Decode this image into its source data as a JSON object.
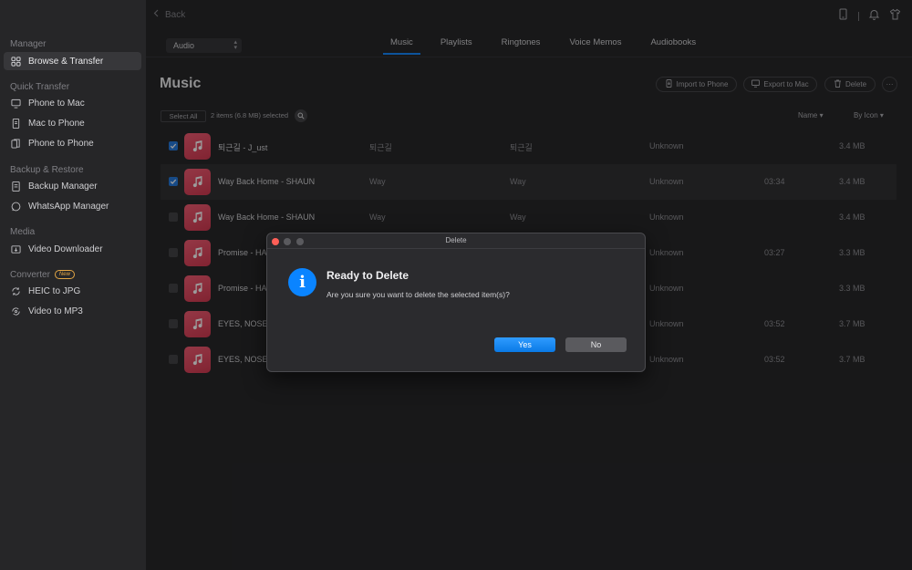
{
  "sidebar": {
    "sections": [
      {
        "label": "Manager",
        "items": [
          {
            "label": "Browse & Transfer",
            "icon": "grid-icon",
            "active": true
          }
        ]
      },
      {
        "label": "Quick Transfer",
        "items": [
          {
            "label": "Phone to Mac",
            "icon": "monitor-icon"
          },
          {
            "label": "Mac to Phone",
            "icon": "phone-icon"
          },
          {
            "label": "Phone to Phone",
            "icon": "phones-icon"
          }
        ]
      },
      {
        "label": "Backup & Restore",
        "items": [
          {
            "label": "Backup Manager",
            "icon": "backup-icon"
          },
          {
            "label": "WhatsApp Manager",
            "icon": "whatsapp-icon"
          }
        ]
      },
      {
        "label": "Media",
        "items": [
          {
            "label": "Video Downloader",
            "icon": "download-icon"
          }
        ]
      },
      {
        "label": "Converter",
        "badge": "New",
        "items": [
          {
            "label": "HEIC to JPG",
            "icon": "convert-icon"
          },
          {
            "label": "Video to MP3",
            "icon": "music-convert-icon"
          }
        ]
      }
    ]
  },
  "header": {
    "back_label": "Back",
    "audio_select": "Audio",
    "tabs": [
      "Music",
      "Playlists",
      "Ringtones",
      "Voice Memos",
      "Audiobooks"
    ],
    "active_tab": "Music"
  },
  "main": {
    "title": "Music",
    "actions": {
      "import": "Import to Phone",
      "export": "Export to Mac",
      "delete": "Delete",
      "more": "···"
    },
    "select_all": "Select All",
    "selection_count": "2 items (6.8 MB) selected",
    "sort_name": "Name",
    "sort_view": "By Icon",
    "rows": [
      {
        "title": "퇴근길 - J_ust",
        "artist": "퇴근길",
        "album": "퇴근길",
        "genre": "Unknown",
        "duration": "",
        "size": "3.4 MB",
        "checked": true
      },
      {
        "title": "Way Back Home - SHAUN",
        "artist": "Way",
        "album": "Way",
        "genre": "Unknown",
        "duration": "03:34",
        "size": "3.4 MB",
        "checked": true
      },
      {
        "title": "Way Back Home - SHAUN",
        "artist": "Way",
        "album": "Way",
        "genre": "Unknown",
        "duration": "",
        "size": "3.4 MB",
        "checked": false
      },
      {
        "title": "Promise - HA",
        "artist": "",
        "album": "",
        "genre": "Unknown",
        "duration": "03:27",
        "size": "3.3 MB",
        "checked": false
      },
      {
        "title": "Promise - HA",
        "artist": "",
        "album": "",
        "genre": "Unknown",
        "duration": "",
        "size": "3.3 MB",
        "checked": false
      },
      {
        "title": "EYES, NOSE,",
        "artist": "",
        "album": "",
        "genre": "Unknown",
        "duration": "03:52",
        "size": "3.7 MB",
        "checked": false
      },
      {
        "title": "EYES, NOSE,",
        "artist": "",
        "album": "",
        "genre": "Unknown",
        "duration": "03:52",
        "size": "3.7 MB",
        "checked": false
      }
    ]
  },
  "dialog": {
    "window_title": "Delete",
    "title": "Ready to Delete",
    "message": "Are you sure you want to delete the selected item(s)?",
    "yes": "Yes",
    "no": "No"
  }
}
